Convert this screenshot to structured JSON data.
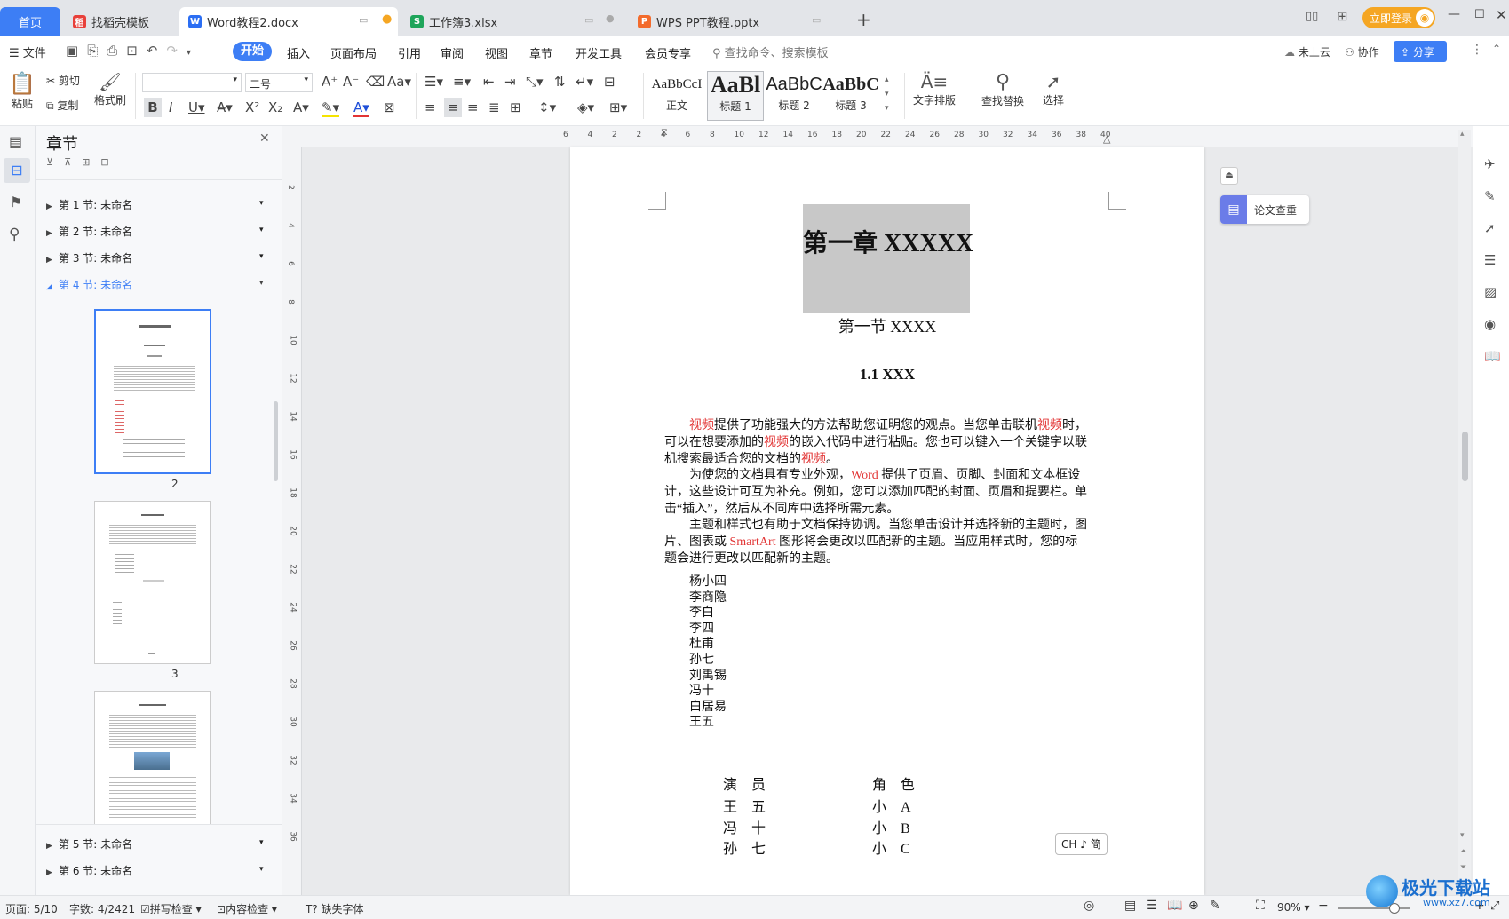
{
  "tabs": {
    "home": "首页",
    "t1": "找稻壳模板",
    "t2": "Word教程2.docx",
    "t3": "工作簿3.xlsx",
    "t4": "WPS PPT教程.pptx",
    "login": "立即登录"
  },
  "menu": {
    "file": "文件",
    "start": "开始",
    "insert": "插入",
    "layout": "页面布局",
    "ref": "引用",
    "review": "审阅",
    "view": "视图",
    "chapter": "章节",
    "dev": "开发工具",
    "member": "会员专享",
    "search_placeholder": "查找命令、搜索模板",
    "cloud": "未上云",
    "collab": "协作",
    "share": "分享"
  },
  "ribbon": {
    "paste": "粘贴",
    "cut": "剪切",
    "copy": "复制",
    "format_painter": "格式刷",
    "font_name": "",
    "font_size": "二号",
    "styles": [
      {
        "sample": "AaBbCcI",
        "label": "正文"
      },
      {
        "sample": "AaBl",
        "label": "标题 1"
      },
      {
        "sample": "AaBbC",
        "label": "标题 2"
      },
      {
        "sample": "AaBbC",
        "label": "标题 3"
      }
    ],
    "text_layout": "文字排版",
    "find_replace": "查找替换",
    "select": "选择"
  },
  "nav": {
    "title": "章节",
    "sections": [
      "第 1 节: 未命名",
      "第 2 节: 未命名",
      "第 3 节: 未命名",
      "第 4 节: 未命名"
    ],
    "sections_bottom": [
      "第 5 节: 未命名",
      "第 6 节: 未命名"
    ],
    "page_numbers": [
      "2",
      "3"
    ]
  },
  "ruler": {
    "h_ticks": [
      "6",
      "4",
      "2",
      "2",
      "4",
      "6",
      "8",
      "10",
      "12",
      "14",
      "16",
      "18",
      "20",
      "22",
      "24",
      "26",
      "28",
      "30",
      "32",
      "34",
      "36",
      "38",
      "40"
    ],
    "v_ticks": [
      "2",
      "4",
      "6",
      "8",
      "10",
      "12",
      "14",
      "16",
      "18",
      "20",
      "22",
      "24",
      "26",
      "28",
      "30",
      "32",
      "34",
      "36"
    ]
  },
  "doc": {
    "chapter_title": "第一章  XXXXX",
    "section_title": "第一节  XXXX",
    "sub_title": "1.1 XXX",
    "para1": [
      {
        "t": "视频",
        "r": true
      },
      {
        "t": "提供了功能强大的方法帮助您证明您的观点。当您单击联机",
        "r": false
      },
      {
        "t": "视频",
        "r": true
      },
      {
        "t": "时，",
        "r": false
      }
    ],
    "para1_l2": [
      {
        "t": "可以在想要添加的",
        "r": false
      },
      {
        "t": "视频",
        "r": true
      },
      {
        "t": "的嵌入代码中进行粘贴。您也可以键入一个关键字以联",
        "r": false
      }
    ],
    "para1_l3": [
      {
        "t": "机搜索最适合您的文档的",
        "r": false
      },
      {
        "t": "视频",
        "r": true
      },
      {
        "t": "。",
        "r": false
      }
    ],
    "para2_l1": [
      {
        "t": "为使您的文档具有专业外观，",
        "r": false
      },
      {
        "t": "Word",
        "r": true
      },
      {
        "t": " 提供了页眉、页脚、封面和文本框设",
        "r": false
      }
    ],
    "para2_l2": "计，这些设计可互为补充。例如，您可以添加匹配的封面、页眉和提要栏。单",
    "para2_l3": "击“插入”，然后从不同库中选择所需元素。",
    "para3_l1": "主题和样式也有助于文档保持协调。当您单击设计并选择新的主题时，图",
    "para3_l2": [
      {
        "t": "片、图表或 ",
        "r": false
      },
      {
        "t": "SmartArt",
        "r": true
      },
      {
        "t": " 图形将会更改以匹配新的主题。当应用样式时，您的标",
        "r": false
      }
    ],
    "para3_l3": "题会进行更改以匹配新的主题。",
    "names": [
      "杨小四",
      "李商隐",
      "李白",
      "李四",
      "杜甫",
      "孙七",
      "刘禹锡",
      "冯十",
      "白居易",
      "王五"
    ],
    "table_headers": [
      "演　员",
      "角　色"
    ],
    "table_rows": [
      [
        "王　五",
        "小　A"
      ],
      [
        "冯　十",
        "小　B"
      ],
      [
        "孙　七",
        "小　C"
      ]
    ]
  },
  "side": {
    "paper_check": "论文查重",
    "ime": "CH ♪ 简"
  },
  "status": {
    "page": "页面: 5/10",
    "words": "字数: 4/2421",
    "spell": "拼写检查",
    "content": "内容检查",
    "missing_font": "缺失字体",
    "zoom": "90%",
    "watermark": "极光下载站",
    "watermark_url": "www.xz7.com"
  },
  "colors": {
    "accent": "#3d7ef5",
    "red_text": "#e23434",
    "login_btn": "#f5a623",
    "heading_bg": "#c8c8c8"
  }
}
